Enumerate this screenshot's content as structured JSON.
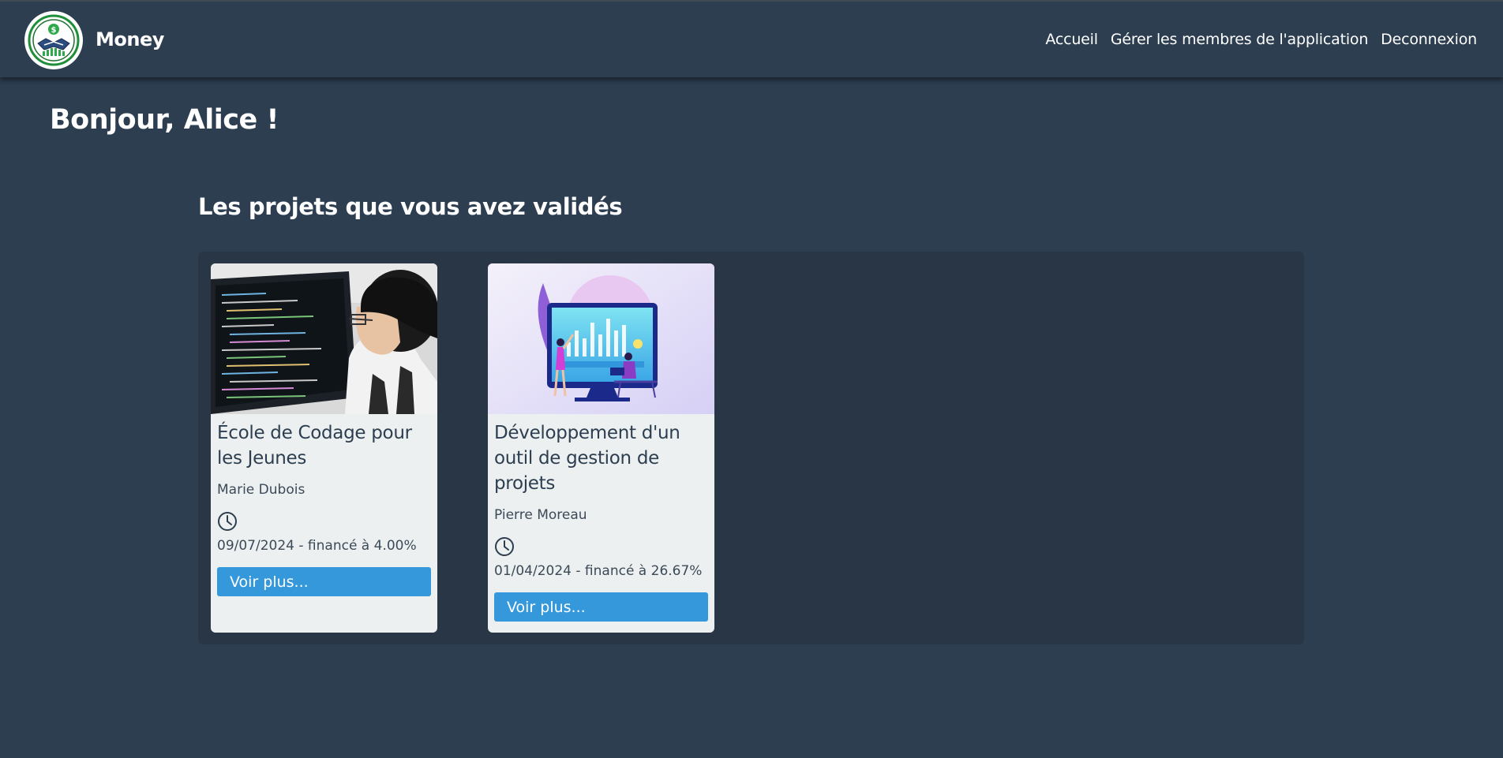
{
  "app": {
    "brand": "Money",
    "logo_icon": "handshake-dollar-logo-icon"
  },
  "nav": {
    "items": [
      {
        "label": "Accueil"
      },
      {
        "label": "Gérer les membres de l'application"
      },
      {
        "label": "Deconnexion"
      }
    ]
  },
  "greeting": "Bonjour, Alice !",
  "section": {
    "title": "Les projets que vous avez validés"
  },
  "projects": [
    {
      "title": "École de Codage pour les Jeunes",
      "author": "Marie Dubois",
      "date_funding": "09/07/2024 - financé à 4.00%",
      "funding_percent": 4.0,
      "button": "Voir plus...",
      "image_icon": "coding-student-photo"
    },
    {
      "title": "Développement d'un outil de gestion de projets",
      "author": "Pierre Moreau",
      "date_funding": "01/04/2024 - financé à 26.67%",
      "funding_percent": 26.67,
      "button": "Voir plus...",
      "image_icon": "dashboard-illustration"
    }
  ],
  "colors": {
    "background": "#2d3e50",
    "navbar": "#2c3e50",
    "panel": "#283645",
    "card": "#ecf0f1",
    "button": "#3498db",
    "text_light": "#ffffff",
    "text_dark": "#2c3e50"
  }
}
